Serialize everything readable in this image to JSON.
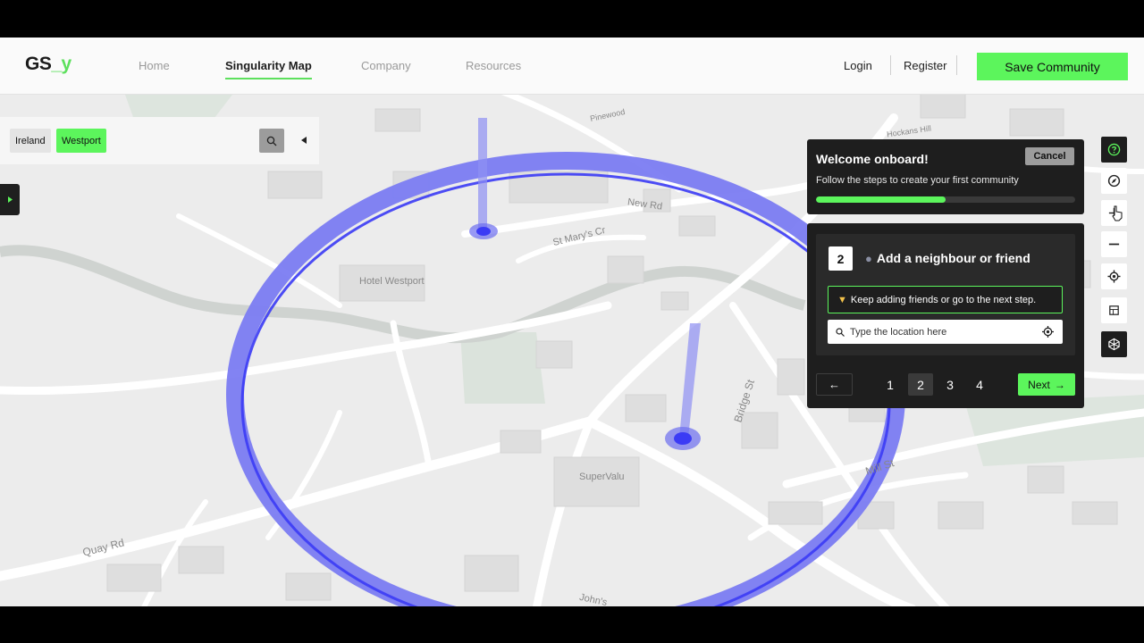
{
  "header": {
    "logo_main": "GS",
    "logo_accent": "_y",
    "nav": [
      {
        "label": "Home"
      },
      {
        "label": "Singularity Map"
      },
      {
        "label": "Company"
      },
      {
        "label": "Resources"
      }
    ],
    "login_label": "Login",
    "register_label": "Register",
    "save_label": "Save Community"
  },
  "search": {
    "chips": [
      "Ireland",
      "Westport"
    ]
  },
  "map": {
    "labels": [
      "Pinewood",
      "Hockans Hill",
      "New Rd",
      "St Mary's Cr",
      "Hotel Westport",
      "Bridge St",
      "SuperValu",
      "Mill St",
      "Quay Rd",
      "John's"
    ],
    "ring_color": "#3b3bf5",
    "ring_fill_color": "#7b7cf2"
  },
  "welcome": {
    "title": "Welcome onboard!",
    "subtitle": "Follow the steps to create your first community",
    "cancel_label": "Cancel",
    "progress": 0.5
  },
  "step": {
    "number": "2",
    "title": "Add a neighbour or friend",
    "hint": "Keep adding friends or go to the next step.",
    "location_placeholder": "Type the location here",
    "back_label": "←",
    "pages": [
      "1",
      "2",
      "3",
      "4"
    ],
    "current_page": "2",
    "next_label": "Next"
  },
  "colors": {
    "accent": "#5cf55c",
    "panel": "#1e1e1e"
  },
  "toolbar": {
    "icons": [
      "help-icon",
      "compass-icon",
      "add-pin-icon",
      "zoom-out-icon",
      "locate-icon",
      "layers-icon",
      "3d-view-icon"
    ]
  }
}
